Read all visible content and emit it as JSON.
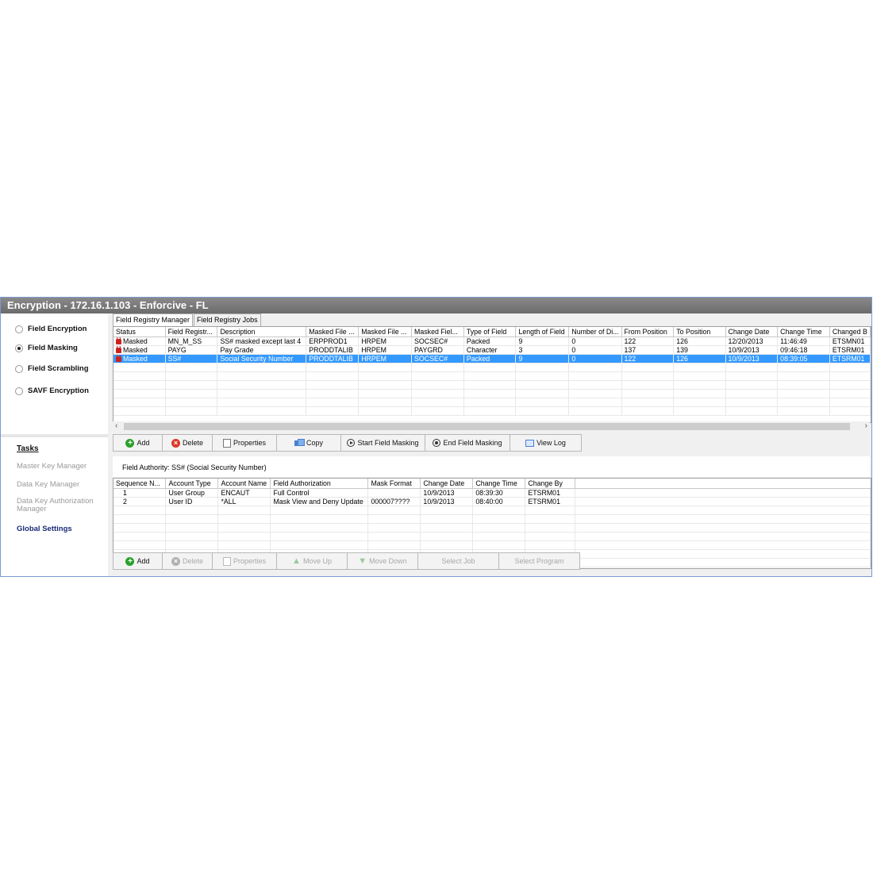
{
  "window": {
    "title": "Encryption - 172.16.1.103 - Enforcive - FL"
  },
  "modes": [
    {
      "label": "Field Encryption",
      "selected": false
    },
    {
      "label": "Field Masking",
      "selected": true
    },
    {
      "label": "Field Scrambling",
      "selected": false
    },
    {
      "label": "SAVF Encryption",
      "selected": false
    }
  ],
  "tasks": {
    "title": "Tasks",
    "items": [
      {
        "label": "Master Key Manager"
      },
      {
        "label": "Data Key Manager"
      },
      {
        "label": "Data Key Authorization Manager"
      },
      {
        "label": "Global Settings"
      }
    ]
  },
  "tabs": [
    {
      "label": "Field Registry Manager"
    },
    {
      "label": "Field Registry Jobs"
    }
  ],
  "registry": {
    "columns": [
      "Status",
      "Field Registr...",
      "Description",
      "Masked File ...",
      "Masked File ...",
      "Masked Fiel...",
      "Type of Field",
      "Length of Field",
      "Number of Di...",
      "From Position",
      "To Position",
      "Change Date",
      "Change Time",
      "Changed B"
    ],
    "rows": [
      [
        "Masked",
        "MN_M_SS",
        "SS# masked except last 4",
        "ERPPROD1",
        "HRPEM",
        "SOCSEC#",
        "Packed",
        "9",
        "0",
        "122",
        "126",
        "12/20/2013",
        "11:46:49",
        "ETSMN01"
      ],
      [
        "Masked",
        "PAYG",
        "Pay Grade",
        "PRODDTALIB",
        "HRPEM",
        "PAYGRD",
        "Character",
        "3",
        "0",
        "137",
        "139",
        "10/9/2013",
        "09:46:18",
        "ETSRM01"
      ],
      [
        "Masked",
        "SS#",
        "Social Security Number",
        "PRODDTALIB",
        "HRPEM",
        "SOCSEC#",
        "Packed",
        "9",
        "0",
        "122",
        "126",
        "10/9/2013",
        "08:39:05",
        "ETSRM01"
      ]
    ]
  },
  "toolbar_top": {
    "add": "Add",
    "delete": "Delete",
    "properties": "Properties",
    "copy": "Copy",
    "start": "Start Field Masking",
    "end": "End Field Masking",
    "viewlog": "View Log"
  },
  "field_authority": {
    "label": "Field Authority:  SS# (Social Security Number)"
  },
  "authority": {
    "columns": [
      "Sequence N...",
      "Account Type",
      "Account Name",
      "Field Authorization",
      "Mask Format",
      "Change Date",
      "Change Time",
      "Change By"
    ],
    "rows": [
      [
        "1",
        "User Group",
        "ENCAUT",
        "Full Control",
        "",
        "10/9/2013",
        "08:39:30",
        "ETSRM01"
      ],
      [
        "2",
        "User ID",
        "*ALL",
        "Mask View and Deny Update",
        "000007????",
        "10/9/2013",
        "08:40:00",
        "ETSRM01"
      ]
    ]
  },
  "toolbar_bottom": {
    "add": "Add",
    "delete": "Delete",
    "properties": "Properties",
    "moveup": "Move Up",
    "movedown": "Move Down",
    "selectjob": "Select Job",
    "selectprogram": "Select Program"
  }
}
